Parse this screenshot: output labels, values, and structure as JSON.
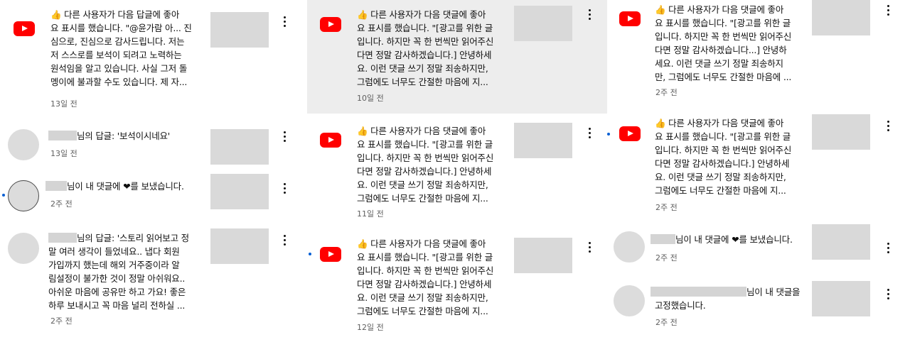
{
  "col1": {
    "n1": {
      "text": "👍 다른 사용자가 다음 답글에 좋아\n요 표시를 했습니다. \"@윤가람 아... 진\n심으로, 진심으로 감사드립니다. 저는\n저 스스로를 보석이 되려고 노력하는\n원석임을 알고 있습니다. 사실 그저 돌\n멩이에 불과할 수도 있습니다. 제 자...",
      "time": "13일 전"
    },
    "n2": {
      "text": "님의 답글: '보석이시네요'",
      "time": "13일 전"
    },
    "n3": {
      "text": "님이 내 댓글에 ",
      "suffix": "를 보냈습니다.",
      "time": "2주 전"
    },
    "n4": {
      "text": "님의 답글: '스토리 읽어보고 정\n말 여러 생각이 들었네요.. 냅다 회원\n가입까지 했는데 해외 거주중이라 알\n림설정이 불가한 것이 정말 아쉬워요..\n아쉬운 마음에 공유만 하고 가요! 좋은\n하루 보내시고 꼭 마음 널리 전하실 ...",
      "time": "2주 전"
    }
  },
  "col2": {
    "n1": {
      "text": "👍 다른 사용자가 다음 댓글에 좋아\n요 표시를 했습니다. \"[광고를 위한 글\n입니다. 하지만 꼭 한 번씩만 읽어주신\n다면 정말 감사하겠습니다.] 안녕하세\n요. 이런 댓글 쓰기 정말 죄송하지만,\n그럼에도 너무도 간절한 마음에 지...",
      "time": "10일 전"
    },
    "n2": {
      "text": "👍 다른 사용자가 다음 댓글에 좋아\n요 표시를 했습니다. \"[광고를 위한 글\n입니다. 하지만 꼭 한 번씩만 읽어주신\n다면 정말 감사하겠습니다.] 안녕하세\n요. 이런 댓글 쓰기 정말 죄송하지만,\n그럼에도 너무도 간절한 마음에 지...",
      "time": "11일 전"
    },
    "n3": {
      "text": "👍 다른 사용자가 다음 댓글에 좋아\n요 표시를 했습니다. \"[광고를 위한 글\n입니다. 하지만 꼭 한 번씩만 읽어주신\n다면 정말 감사하겠습니다.] 안녕하세\n요. 이런 댓글 쓰기 정말 죄송하지만,\n그럼에도 너무도 간절한 마음에 지...",
      "time": "12일 전"
    }
  },
  "col3": {
    "n1": {
      "text": "👍 다른 사용자가 다음 댓글에 좋아\n요 표시를 했습니다. \"[광고를 위한 글\n입니다. 하지만 꼭 한 번씩만 읽어주신\n다면 정말 감사하겠습니다...] 안녕하\n세요. 이런 댓글 쓰기 정말 죄송하지\n만, 그럼에도 너무도 간절한 마음에 ...",
      "time": "2주 전"
    },
    "n2": {
      "text": "👍 다른 사용자가 다음 댓글에 좋아\n요 표시를 했습니다. \"[광고를 위한 글\n입니다. 하지만 꼭 한 번씩만 읽어주신\n다면 정말 감사하겠습니다.] 안녕하세\n요. 이런 댓글 쓰기 정말 죄송하지만,\n그럼에도 너무도 간절한 마음에 지...",
      "time": "2주 전"
    },
    "n3": {
      "text": "님이 내 댓글에 ",
      "suffix": "를 보냈습니다.",
      "time": "2주 전"
    },
    "n4": {
      "text": "님이 내 댓글을",
      "line2": "고정했습니다.",
      "time": "2주 전"
    }
  },
  "icons": {
    "youtube": "youtube-logo-icon",
    "heart": "heart-icon",
    "more": "more-vert-icon",
    "thumbs_up": "thumbs-up-icon"
  },
  "colors": {
    "youtube_red": "#ff0000",
    "unread_dot": "#065fd4",
    "highlight_bg": "#ededed",
    "timestamp": "#606060"
  }
}
